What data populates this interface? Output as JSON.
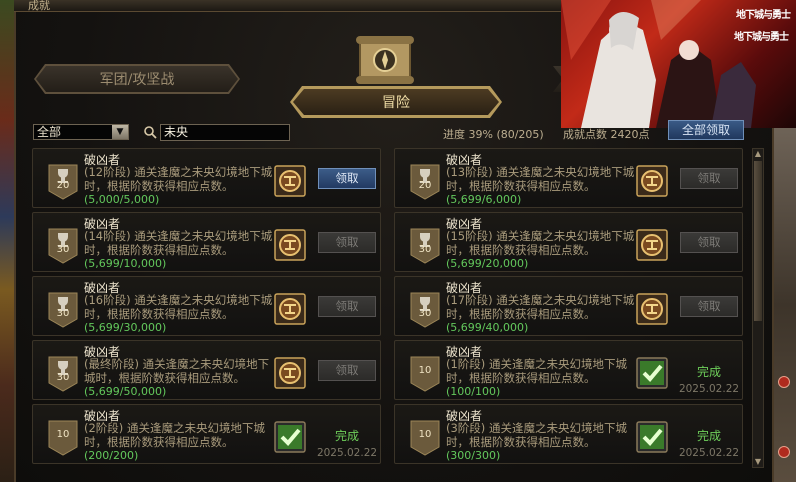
{
  "window": {
    "title": "成就"
  },
  "tabs": [
    {
      "label": "军团/攻坚战",
      "active": false
    },
    {
      "label": "冒险",
      "active": true
    }
  ],
  "filter": {
    "category": "全部",
    "search_value": "未央"
  },
  "summary": {
    "progress": "进度   39% (80/205)",
    "points": "成就点数 2420点",
    "all_button": "全部领取"
  },
  "banner": {
    "logo_line1": "地下城与勇士",
    "logo_line2": "地下城与勇士"
  },
  "achievements": [
    {
      "title": "破凶者",
      "desc": "(12阶段) 通关逢魔之未央幻境地下城时，根据阶数获得相应点数。",
      "progress": "(5,000/5,000)",
      "points": "20",
      "state": "claim",
      "action": "领取",
      "date": ""
    },
    {
      "title": "破凶者",
      "desc": "(13阶段) 通关逢魔之未央幻境地下城时，根据阶数获得相应点数。",
      "progress": "(5,699/6,000)",
      "points": "20",
      "state": "disabled",
      "action": "领取",
      "date": ""
    },
    {
      "title": "破凶者",
      "desc": "(14阶段) 通关逢魔之未央幻境地下城时，根据阶数获得相应点数。",
      "progress": "(5,699/10,000)",
      "points": "30",
      "state": "disabled",
      "action": "领取",
      "date": ""
    },
    {
      "title": "破凶者",
      "desc": "(15阶段) 通关逢魔之未央幻境地下城时，根据阶数获得相应点数。",
      "progress": "(5,699/20,000)",
      "points": "30",
      "state": "disabled",
      "action": "领取",
      "date": ""
    },
    {
      "title": "破凶者",
      "desc": "(16阶段) 通关逢魔之未央幻境地下城时，根据阶数获得相应点数。",
      "progress": "(5,699/30,000)",
      "points": "30",
      "state": "disabled",
      "action": "领取",
      "date": ""
    },
    {
      "title": "破凶者",
      "desc": "(17阶段) 通关逢魔之未央幻境地下城时，根据阶数获得相应点数。",
      "progress": "(5,699/40,000)",
      "points": "30",
      "state": "disabled",
      "action": "领取",
      "date": ""
    },
    {
      "title": "破凶者",
      "desc": "(最终阶段) 通关逢魔之未央幻境地下城时，根据阶数获得相应点数。",
      "progress": "(5,699/50,000)",
      "points": "30",
      "state": "disabled",
      "action": "领取",
      "date": ""
    },
    {
      "title": "破凶者",
      "desc": "(1阶段) 通关逢魔之未央幻境地下城时，根据阶数获得相应点数。",
      "progress": "(100/100)",
      "points": "10",
      "state": "done",
      "action": "完成",
      "date": "2025.02.22"
    },
    {
      "title": "破凶者",
      "desc": "(2阶段) 通关逢魔之未央幻境地下城时，根据阶数获得相应点数。",
      "progress": "(200/200)",
      "points": "10",
      "state": "done",
      "action": "完成",
      "date": "2025.02.22"
    },
    {
      "title": "破凶者",
      "desc": "(3阶段) 通关逢魔之未央幻境地下城时，根据阶数获得相应点数。",
      "progress": "(300/300)",
      "points": "10",
      "state": "done",
      "action": "完成",
      "date": "2025.02.22"
    }
  ],
  "colors": {
    "accent_gold": "#b59a5c",
    "progress_green": "#63c85c",
    "claim_blue": "#3c5c88"
  }
}
